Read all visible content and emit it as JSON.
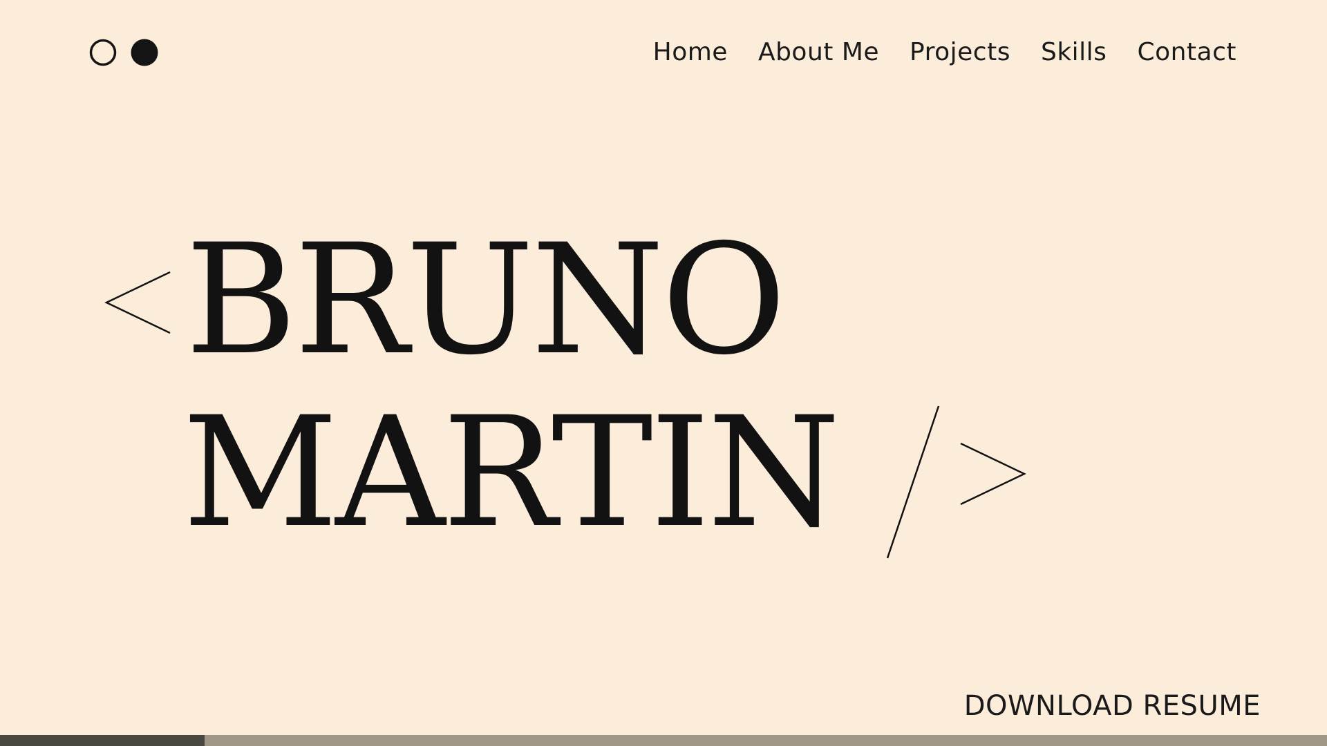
{
  "logo": {
    "icon": "two-circles-logo"
  },
  "nav": {
    "items": [
      {
        "label": "Home"
      },
      {
        "label": "About Me"
      },
      {
        "label": "Projects"
      },
      {
        "label": "Skills"
      },
      {
        "label": "Contact"
      }
    ]
  },
  "hero": {
    "line1": "BRUNO",
    "line2": "MARTIN",
    "open_bracket": "<",
    "close_slash": "/",
    "close_bracket": ">"
  },
  "cta": {
    "download_label": "DOWNLOAD RESUME"
  },
  "progress": {
    "fraction": 0.154
  },
  "colors": {
    "background": "#fcecda",
    "text": "#121212",
    "progress_track": "#a09786",
    "progress_fill": "#4a4741"
  }
}
